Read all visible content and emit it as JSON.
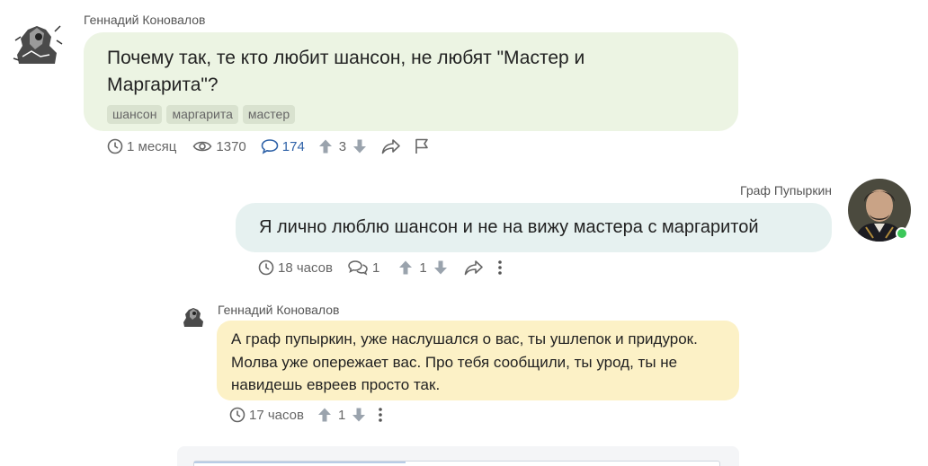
{
  "question": {
    "author": "Геннадий Коновалов",
    "text": "Почему так, те кто любит шансон, не любят \"Мастер и Маргарита\"?",
    "tags": [
      "шансон",
      "маргарита",
      "мастер"
    ],
    "meta": {
      "time": "1 месяц",
      "views": "1370",
      "comments": "174",
      "votes": "3"
    }
  },
  "reply": {
    "author": "Граф Пупыркин",
    "text": "Я лично люблю шансон и не на вижу мастера с маргаритой",
    "meta": {
      "time": "18 часов",
      "replies": "1",
      "votes": "1"
    }
  },
  "nested_reply": {
    "author": "Геннадий Коновалов",
    "text": "А граф пупыркин, уже наслушался о вас, ты ушлепок и придурок. Молва уже опережает вас. Про тебя сообщили, ты урод, ты не навидешь евреев просто так.",
    "meta": {
      "time": "17 часов",
      "votes": "1"
    }
  },
  "colors": {
    "question_bubble": "#ecf4e3",
    "reply_bubble": "#e6f1f0",
    "nested_bubble": "#fcf1c6",
    "link_blue": "#2f62a8",
    "online": "#3cc75a"
  }
}
